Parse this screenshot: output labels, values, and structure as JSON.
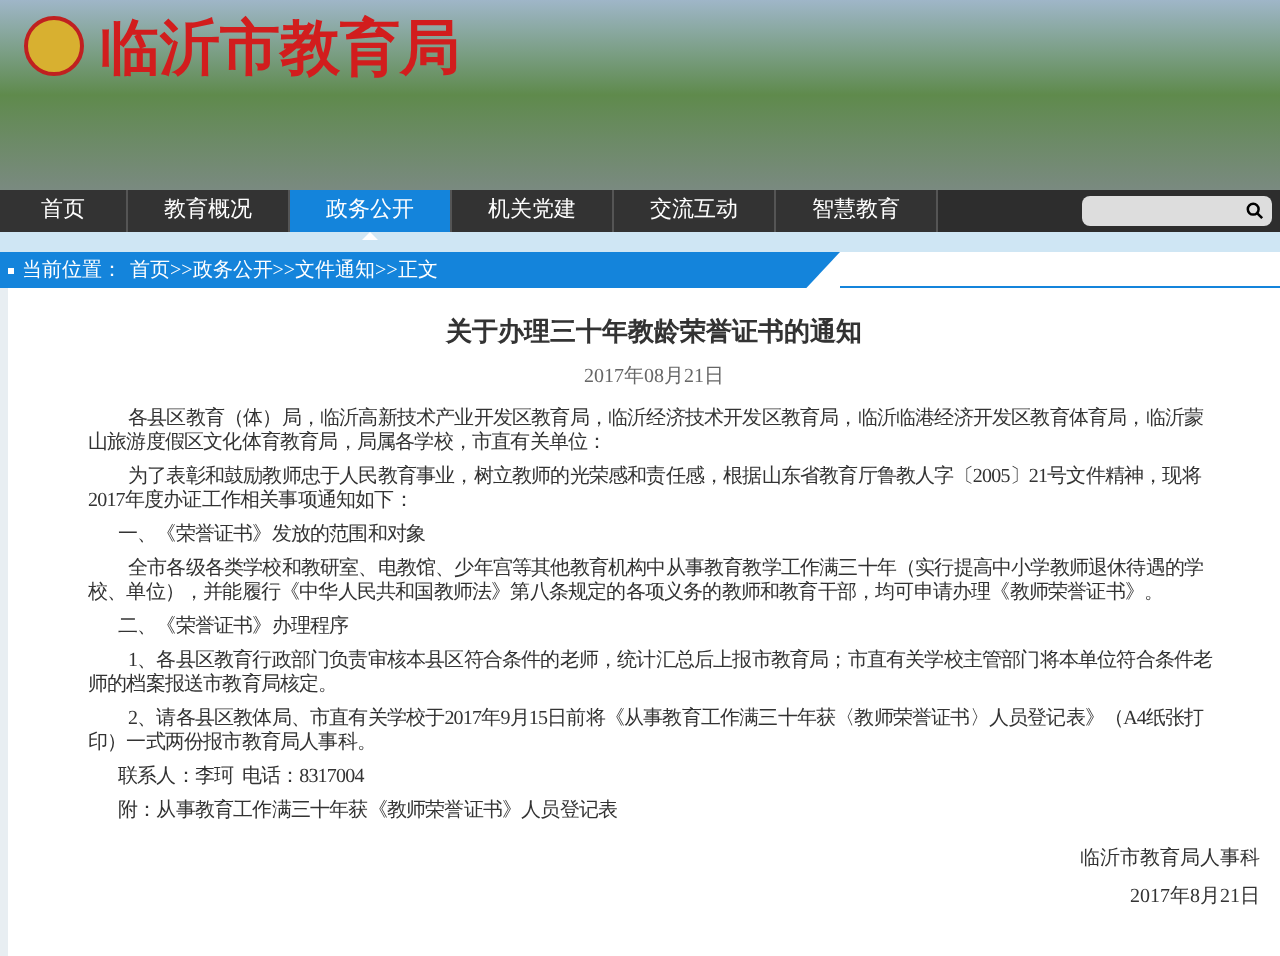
{
  "header": {
    "site_title": "临沂市教育局"
  },
  "nav": {
    "items": [
      {
        "label": "首页",
        "selected": false
      },
      {
        "label": "教育概况",
        "selected": false
      },
      {
        "label": "政务公开",
        "selected": true
      },
      {
        "label": "机关党建",
        "selected": false
      },
      {
        "label": "交流互动",
        "selected": false
      },
      {
        "label": "智慧教育",
        "selected": false
      }
    ]
  },
  "breadcrumb": {
    "label": "当前位置：",
    "path": "首页>>政务公开>>文件通知>>正文"
  },
  "article": {
    "title": "关于办理三十年教龄荣誉证书的通知",
    "date": "2017年08月21日",
    "paragraphs": [
      {
        "kind": "body",
        "text": "各县区教育（体）局，临沂高新技术产业开发区教育局，临沂经济技术开发区教育局，临沂临港经济开发区教育体育局，临沂蒙山旅游度假区文化体育教育局，局属各学校，市直有关单位："
      },
      {
        "kind": "body",
        "text": "为了表彰和鼓励教师忠于人民教育事业，树立教师的光荣感和责任感，根据山东省教育厅鲁教人字〔2005〕21号文件精神，现将2017年度办证工作相关事项通知如下："
      },
      {
        "kind": "heading",
        "text": "一、《荣誉证书》发放的范围和对象"
      },
      {
        "kind": "body",
        "text": "全市各级各类学校和教研室、电教馆、少年宫等其他教育机构中从事教育教学工作满三十年（实行提高中小学教师退休待遇的学校、单位），并能履行《中华人民共和国教师法》第八条规定的各项义务的教师和教育干部，均可申请办理《教师荣誉证书》。"
      },
      {
        "kind": "heading",
        "text": "二、《荣誉证书》办理程序"
      },
      {
        "kind": "body",
        "text": "1、各县区教育行政部门负责审核本县区符合条件的老师，统计汇总后上报市教育局；市直有关学校主管部门将本单位符合条件老师的档案报送市教育局核定。"
      },
      {
        "kind": "body",
        "text": "2、请各县区教体局、市直有关学校于2017年9月15日前将《从事教育工作满三十年获〈教师荣誉证书〉人员登记表》（A4纸张打印）一式两份报市教育局人事科。"
      },
      {
        "kind": "heading",
        "text": "联系人：李珂  电话：8317004"
      },
      {
        "kind": "heading",
        "text": "附：从事教育工作满三十年获《教师荣誉证书》人员登记表"
      }
    ],
    "signature": "临沂市教育局人事科",
    "signature_date": "2017年8月21日"
  }
}
